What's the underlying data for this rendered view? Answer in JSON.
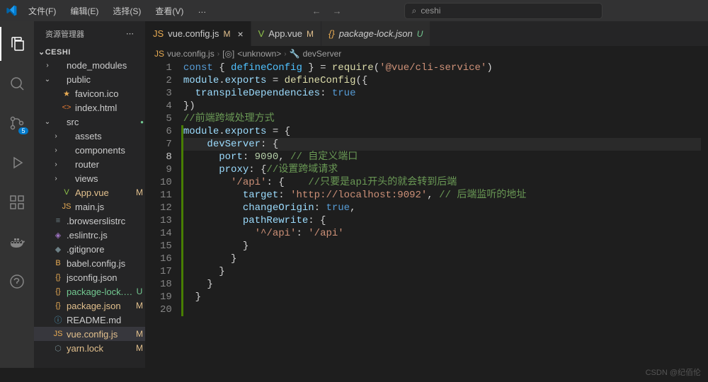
{
  "menu": [
    "文件(F)",
    "编辑(E)",
    "选择(S)",
    "查看(V)",
    "…"
  ],
  "search_placeholder": "ceshi",
  "sidebar_title": "资源管理器",
  "project": "CESHI",
  "tree": [
    {
      "type": "folder",
      "label": "node_modules",
      "open": false,
      "indent": 1
    },
    {
      "type": "folder",
      "label": "public",
      "open": true,
      "indent": 1
    },
    {
      "type": "file",
      "label": "favicon.ico",
      "icon": "★",
      "iconClass": "ic-yellow",
      "indent": 2
    },
    {
      "type": "file",
      "label": "index.html",
      "icon": "<>",
      "iconClass": "ic-orange",
      "indent": 2
    },
    {
      "type": "folder",
      "label": "src",
      "open": true,
      "indent": 1,
      "circle": true
    },
    {
      "type": "folder",
      "label": "assets",
      "open": false,
      "indent": 2
    },
    {
      "type": "folder",
      "label": "components",
      "open": false,
      "indent": 2
    },
    {
      "type": "folder",
      "label": "router",
      "open": false,
      "indent": 2
    },
    {
      "type": "folder",
      "label": "views",
      "open": false,
      "indent": 2
    },
    {
      "type": "file",
      "label": "App.vue",
      "icon": "V",
      "iconClass": "ic-green",
      "indent": 2,
      "status": "M",
      "sc": "m"
    },
    {
      "type": "file",
      "label": "main.js",
      "icon": "JS",
      "iconClass": "ic-yellow",
      "indent": 2
    },
    {
      "type": "file",
      "label": ".browserslistrc",
      "icon": "≡",
      "iconClass": "ic-gray",
      "indent": 1
    },
    {
      "type": "file",
      "label": ".eslintrc.js",
      "icon": "◈",
      "iconClass": "ic-purple",
      "indent": 1
    },
    {
      "type": "file",
      "label": ".gitignore",
      "icon": "◆",
      "iconClass": "ic-gray",
      "indent": 1
    },
    {
      "type": "file",
      "label": "babel.config.js",
      "icon": "B",
      "iconClass": "ic-yellow",
      "indent": 1
    },
    {
      "type": "file",
      "label": "jsconfig.json",
      "icon": "{}",
      "iconClass": "ic-yellow",
      "indent": 1
    },
    {
      "type": "file",
      "label": "package-lock.json",
      "icon": "{}",
      "iconClass": "ic-yellow",
      "indent": 1,
      "status": "U",
      "sc": "u"
    },
    {
      "type": "file",
      "label": "package.json",
      "icon": "{}",
      "iconClass": "ic-yellow",
      "indent": 1,
      "status": "M",
      "sc": "m"
    },
    {
      "type": "file",
      "label": "README.md",
      "icon": "ⓘ",
      "iconClass": "ic-cyan",
      "indent": 1
    },
    {
      "type": "file",
      "label": "vue.config.js",
      "icon": "JS",
      "iconClass": "ic-yellow",
      "indent": 1,
      "status": "M",
      "sc": "m",
      "selected": true
    },
    {
      "type": "file",
      "label": "yarn.lock",
      "icon": "⬡",
      "iconClass": "ic-gray",
      "indent": 1,
      "status": "M",
      "sc": "m"
    }
  ],
  "tabs": [
    {
      "icon": "JS",
      "iconClass": "ic-yellow",
      "label": "vue.config.js",
      "mod": "M",
      "active": true,
      "close": true
    },
    {
      "icon": "V",
      "iconClass": "ic-green",
      "label": "App.vue",
      "mod": "M"
    },
    {
      "icon": "{}",
      "iconClass": "ic-yellow",
      "label": "package-lock.json",
      "unt": "U",
      "italic": true
    }
  ],
  "breadcrumb": [
    {
      "icon": "JS",
      "iconClass": "ic-yellow",
      "text": "vue.config.js"
    },
    {
      "icon": "[◎]",
      "text": "<unknown>"
    },
    {
      "icon": "🔧",
      "text": "devServer"
    }
  ],
  "code": [
    {
      "n": 1,
      "tokens": [
        [
          "k-keyword",
          "const"
        ],
        [
          "k-punc",
          " { "
        ],
        [
          "k-const",
          "defineConfig"
        ],
        [
          "k-punc",
          " } = "
        ],
        [
          "k-func",
          "require"
        ],
        [
          "k-punc",
          "("
        ],
        [
          "k-string",
          "'@vue/cli-service'"
        ],
        [
          "k-punc",
          ")"
        ]
      ]
    },
    {
      "n": 2,
      "tokens": [
        [
          "k-prop",
          "module"
        ],
        [
          "k-punc",
          "."
        ],
        [
          "k-prop",
          "exports"
        ],
        [
          "k-punc",
          " = "
        ],
        [
          "k-func",
          "defineConfig"
        ],
        [
          "k-punc",
          "({"
        ]
      ]
    },
    {
      "n": 3,
      "tokens": [
        [
          "k-punc",
          "  "
        ],
        [
          "k-prop",
          "transpileDependencies"
        ],
        [
          "k-punc",
          ": "
        ],
        [
          "k-bool",
          "true"
        ]
      ]
    },
    {
      "n": 4,
      "tokens": [
        [
          "k-punc",
          "})"
        ]
      ]
    },
    {
      "n": 5,
      "tokens": [
        [
          "",
          ""
        ]
      ]
    },
    {
      "n": 6,
      "mod": true,
      "tokens": [
        [
          "k-comment",
          "//前端跨域处理方式"
        ]
      ]
    },
    {
      "n": 7,
      "mod": true,
      "tokens": [
        [
          "k-prop",
          "module"
        ],
        [
          "k-punc",
          "."
        ],
        [
          "k-prop",
          "exports"
        ],
        [
          "k-punc",
          " = {"
        ]
      ]
    },
    {
      "n": 8,
      "mod": true,
      "hl": true,
      "tokens": [
        [
          "k-punc",
          "    "
        ],
        [
          "k-prop",
          "devServer"
        ],
        [
          "k-punc",
          ": {"
        ]
      ]
    },
    {
      "n": 9,
      "mod": true,
      "tokens": [
        [
          "k-punc",
          "      "
        ],
        [
          "k-prop",
          "port"
        ],
        [
          "k-punc",
          ": "
        ],
        [
          "k-num",
          "9090"
        ],
        [
          "k-punc",
          ", "
        ],
        [
          "k-comment",
          "// 自定义端口"
        ]
      ]
    },
    {
      "n": 10,
      "mod": true,
      "tokens": [
        [
          "k-punc",
          "      "
        ],
        [
          "k-prop",
          "proxy"
        ],
        [
          "k-punc",
          ": {"
        ],
        [
          "k-comment",
          "//设置跨域请求"
        ]
      ]
    },
    {
      "n": 11,
      "mod": true,
      "tokens": [
        [
          "k-punc",
          "        "
        ],
        [
          "k-string",
          "'/api'"
        ],
        [
          "k-punc",
          ": {    "
        ],
        [
          "k-comment",
          "//只要是api开头的就会转到后端"
        ]
      ]
    },
    {
      "n": 12,
      "mod": true,
      "tokens": [
        [
          "k-punc",
          "          "
        ],
        [
          "k-prop",
          "target"
        ],
        [
          "k-punc",
          ": "
        ],
        [
          "k-string",
          "'http://localhost:9092'"
        ],
        [
          "k-punc",
          ", "
        ],
        [
          "k-comment",
          "// 后端监听的地址"
        ]
      ]
    },
    {
      "n": 13,
      "mod": true,
      "tokens": [
        [
          "k-punc",
          "          "
        ],
        [
          "k-prop",
          "changeOrigin"
        ],
        [
          "k-punc",
          ": "
        ],
        [
          "k-bool",
          "true"
        ],
        [
          "k-punc",
          ","
        ]
      ]
    },
    {
      "n": 14,
      "mod": true,
      "tokens": [
        [
          "k-punc",
          "          "
        ],
        [
          "k-prop",
          "pathRewrite"
        ],
        [
          "k-punc",
          ": {"
        ]
      ]
    },
    {
      "n": 15,
      "mod": true,
      "tokens": [
        [
          "k-punc",
          "            "
        ],
        [
          "k-string",
          "'^/api'"
        ],
        [
          "k-punc",
          ": "
        ],
        [
          "k-string",
          "'/api'"
        ]
      ]
    },
    {
      "n": 16,
      "mod": true,
      "tokens": [
        [
          "k-punc",
          "          }"
        ]
      ]
    },
    {
      "n": 17,
      "mod": true,
      "tokens": [
        [
          "k-punc",
          "        }"
        ]
      ]
    },
    {
      "n": 18,
      "mod": true,
      "tokens": [
        [
          "k-punc",
          "      }"
        ]
      ]
    },
    {
      "n": 19,
      "mod": true,
      "tokens": [
        [
          "k-punc",
          "    }"
        ]
      ]
    },
    {
      "n": 20,
      "mod": true,
      "tokens": [
        [
          "k-punc",
          "  }"
        ]
      ]
    }
  ],
  "watermark": "CSDN @纪佰伦",
  "scm_badge": "5"
}
